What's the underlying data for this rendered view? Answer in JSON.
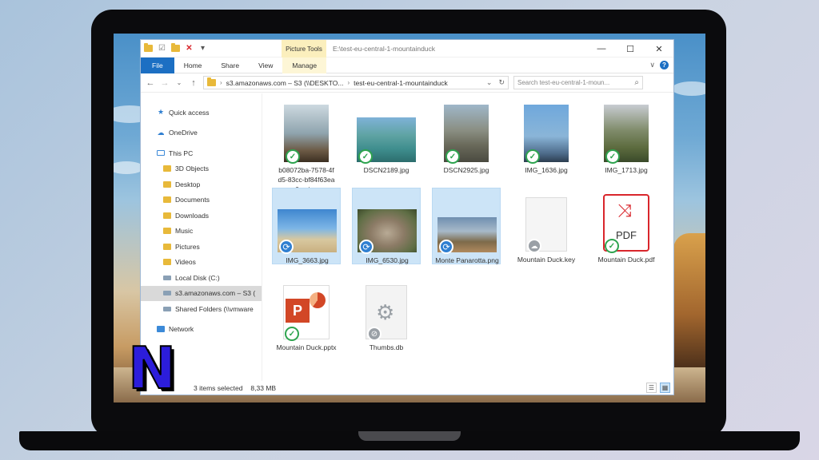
{
  "window": {
    "title_path": "E:\\test-eu-central-1-mountainduck",
    "context_tab": "Picture Tools",
    "controls": {
      "minimize": "—",
      "maximize": "☐",
      "close": "✕"
    }
  },
  "quick_access_toolbar": [
    "folder-icon",
    "properties-icon",
    "folder-icon",
    "delete-icon"
  ],
  "ribbon": {
    "tabs": [
      "File",
      "Home",
      "Share",
      "View",
      "Manage"
    ],
    "expand": "∨",
    "help": "?"
  },
  "address": {
    "back": "←",
    "forward": "→",
    "recent": "⌄",
    "up": "↑",
    "segments": [
      "s3.amazonaws.com – S3 (\\\\DESKTO...",
      "test-eu-central-1-mountainduck"
    ],
    "dropdown": "⌄",
    "refresh": "↻",
    "search_placeholder": "Search test-eu-central-1-moun..."
  },
  "navigation": [
    {
      "label": "Quick access",
      "icon": "star-icon",
      "level": 1
    },
    {
      "label": "OneDrive",
      "icon": "cloud-icon",
      "level": 1,
      "gap": true
    },
    {
      "label": "This PC",
      "icon": "pc-icon",
      "level": 1,
      "gap": true
    },
    {
      "label": "3D Objects",
      "icon": "folder-icon",
      "level": 2
    },
    {
      "label": "Desktop",
      "icon": "folder-icon",
      "level": 2
    },
    {
      "label": "Documents",
      "icon": "folder-icon",
      "level": 2
    },
    {
      "label": "Downloads",
      "icon": "folder-icon",
      "level": 2
    },
    {
      "label": "Music",
      "icon": "folder-icon",
      "level": 2
    },
    {
      "label": "Pictures",
      "icon": "folder-icon",
      "level": 2
    },
    {
      "label": "Videos",
      "icon": "folder-icon",
      "level": 2
    },
    {
      "label": "Local Disk (C:)",
      "icon": "drive-icon",
      "level": 2
    },
    {
      "label": "s3.amazonaws.com – S3 (",
      "icon": "network-drive-icon",
      "level": 2,
      "selected": true
    },
    {
      "label": "Shared Folders (\\\\vmware",
      "icon": "network-drive-icon",
      "level": 2
    },
    {
      "label": "Network",
      "icon": "network-icon",
      "level": 1,
      "gap": true
    }
  ],
  "files": [
    {
      "name": "b08072ba-7578-4fd5-83cc-bf84f63ea6aa.jpg",
      "status": "synced",
      "selected": false
    },
    {
      "name": "DSCN2189.jpg",
      "status": "synced",
      "selected": false
    },
    {
      "name": "DSCN2925.jpg",
      "status": "synced",
      "selected": false
    },
    {
      "name": "IMG_1636.jpg",
      "status": "synced",
      "selected": false
    },
    {
      "name": "IMG_1713.jpg",
      "status": "synced",
      "selected": false
    },
    {
      "name": "IMG_3663.jpg",
      "status": "syncing",
      "selected": true
    },
    {
      "name": "IMG_6530.jpg",
      "status": "syncing",
      "selected": true
    },
    {
      "name": "Monte Panarotta.png",
      "status": "syncing",
      "selected": true
    },
    {
      "name": "Mountain Duck.key",
      "status": "online-only",
      "selected": false
    },
    {
      "name": "Mountain Duck.pdf",
      "status": "synced",
      "selected": false
    },
    {
      "name": "Mountain Duck.pptx",
      "status": "synced",
      "selected": false
    },
    {
      "name": "Thumbs.db",
      "status": "ignored",
      "selected": false
    }
  ],
  "pdf_label": "PDF",
  "pptx_letter": "P",
  "status": {
    "selection": "3 items selected",
    "size": "8,33 MB"
  },
  "logo_letter": "N",
  "colors": {
    "accent": "#1c6fc3",
    "selection": "#cce4f7",
    "synced": "#2ea44f",
    "syncing": "#2f7fd1",
    "logo": "#2c1ddb"
  }
}
